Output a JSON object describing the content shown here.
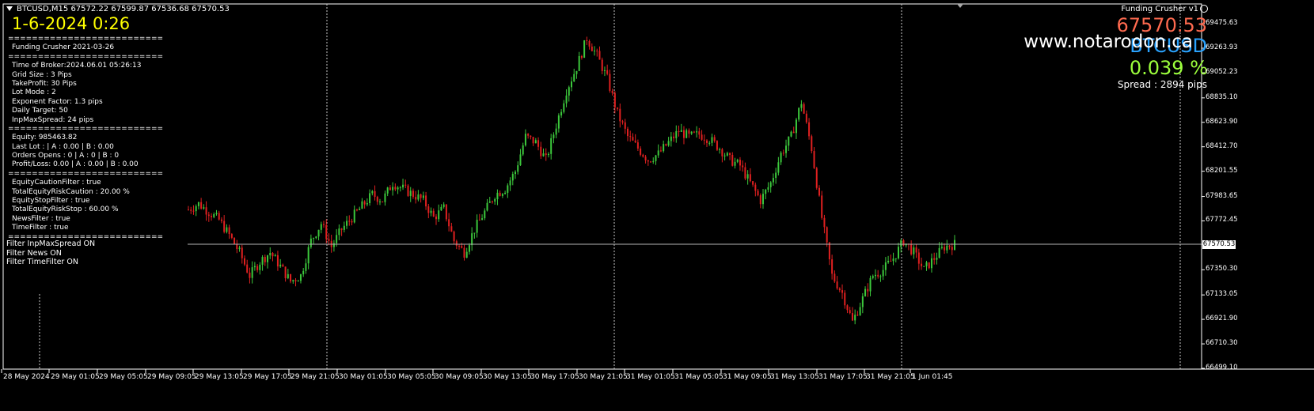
{
  "header": {
    "symbol_line": "BTCUSD,M15  67572.22 67599.87 67536.68 67570.53"
  },
  "clock": "1-6-2024 0:26",
  "info_lines": [
    "==========================",
    "Funding Crusher 2021-03-26",
    "==========================",
    "Time of Broker:2024.06.01 05:26:13",
    "Grid Size : 3 Pips",
    "TakeProfit: 30 Pips",
    "Lot Mode : 2",
    "Exponent Factor: 1.3 pips",
    "Daily Target: 50",
    "InpMaxSpread: 24 pips",
    "==========================",
    "Equity:       985463.82",
    "Last Lot :  | A : 0.00 | B : 0.00",
    "Orders Opens :    0  | A : 0 | B : 0",
    "Profit/Loss: 0.00  | A : 0.00 | B : 0.00",
    "==========================",
    "EquityCautionFilter : true",
    "TotalEquityRiskCaution : 20.00 %",
    "EquityStopFilter : true",
    "TotalEquityRiskStop : 60.00 %",
    "NewsFilter : true",
    "TimeFilter : true",
    "=========================="
  ],
  "filters": [
    "Filter InpMaxSpread ON",
    "Filter News ON",
    "Filter TimeFilter ON"
  ],
  "ea_name": "Funding Crusher v1",
  "big_price": "67570.53",
  "big_symbol": "BTCUSD",
  "watermark": "www.notarodon.ca",
  "percent": "0.039 %",
  "spread": "Spread : 2894 pips",
  "current_price": "67570.53",
  "y_axis": [
    "69475.63",
    "69263.93",
    "69052.23",
    "68835.10",
    "68623.90",
    "68412.70",
    "68201.55",
    "67983.65",
    "67772.45",
    "67570.53",
    "67350.30",
    "67133.05",
    "66921.90",
    "66710.30",
    "66499.10"
  ],
  "x_axis": [
    "28 May 2024",
    "29 May 01:05",
    "29 May 05:05",
    "29 May 09:05",
    "29 May 13:05",
    "29 May 17:05",
    "29 May 21:05",
    "30 May 01:05",
    "30 May 05:05",
    "30 May 09:05",
    "30 May 13:05",
    "30 May 17:05",
    "30 May 21:05",
    "31 May 01:05",
    "31 May 05:05",
    "31 May 09:05",
    "31 May 13:05",
    "31 May 17:05",
    "31 May 21:05",
    "1 Jun 01:45"
  ],
  "colors": {
    "bull": "#3cc83c",
    "bear": "#e02020",
    "grid": "#c8c8c8",
    "price_line": "#b4b4b4"
  },
  "chart_data": {
    "type": "candlestick",
    "symbol": "BTCUSD",
    "timeframe": "M15",
    "last_price": 67570.53,
    "ylim": [
      66499.1,
      69475.63
    ],
    "close_path": [
      [
        0,
        67870
      ],
      [
        4,
        67920
      ],
      [
        8,
        67850
      ],
      [
        12,
        67780
      ],
      [
        16,
        67650
      ],
      [
        20,
        67500
      ],
      [
        24,
        67300
      ],
      [
        28,
        67420
      ],
      [
        32,
        67500
      ],
      [
        36,
        67380
      ],
      [
        40,
        67250
      ],
      [
        44,
        67300
      ],
      [
        48,
        67600
      ],
      [
        52,
        67750
      ],
      [
        56,
        67550
      ],
      [
        60,
        67700
      ],
      [
        64,
        67800
      ],
      [
        68,
        67900
      ],
      [
        72,
        68000
      ],
      [
        76,
        67950
      ],
      [
        80,
        68100
      ],
      [
        84,
        68050
      ],
      [
        88,
        68000
      ],
      [
        92,
        67950
      ],
      [
        96,
        67800
      ],
      [
        100,
        67880
      ],
      [
        104,
        67600
      ],
      [
        108,
        67500
      ],
      [
        112,
        67700
      ],
      [
        116,
        67850
      ],
      [
        120,
        68000
      ],
      [
        124,
        68050
      ],
      [
        128,
        68200
      ],
      [
        132,
        68500
      ],
      [
        136,
        68450
      ],
      [
        140,
        68300
      ],
      [
        144,
        68600
      ],
      [
        148,
        68900
      ],
      [
        152,
        69100
      ],
      [
        156,
        69350
      ],
      [
        160,
        69200
      ],
      [
        164,
        69000
      ],
      [
        168,
        68700
      ],
      [
        172,
        68500
      ],
      [
        176,
        68400
      ],
      [
        180,
        68300
      ],
      [
        184,
        68350
      ],
      [
        188,
        68450
      ],
      [
        192,
        68550
      ],
      [
        196,
        68500
      ],
      [
        200,
        68520
      ],
      [
        204,
        68480
      ],
      [
        208,
        68400
      ],
      [
        212,
        68300
      ],
      [
        216,
        68250
      ],
      [
        220,
        68100
      ],
      [
        224,
        67950
      ],
      [
        228,
        68100
      ],
      [
        232,
        68350
      ],
      [
        236,
        68500
      ],
      [
        240,
        68800
      ],
      [
        244,
        68400
      ],
      [
        248,
        67800
      ],
      [
        252,
        67300
      ],
      [
        256,
        67150
      ],
      [
        260,
        66900
      ],
      [
        264,
        67100
      ],
      [
        268,
        67300
      ],
      [
        272,
        67350
      ],
      [
        276,
        67450
      ],
      [
        280,
        67600
      ],
      [
        284,
        67500
      ],
      [
        288,
        67350
      ],
      [
        292,
        67450
      ],
      [
        296,
        67550
      ],
      [
        300,
        67570.53
      ]
    ]
  }
}
